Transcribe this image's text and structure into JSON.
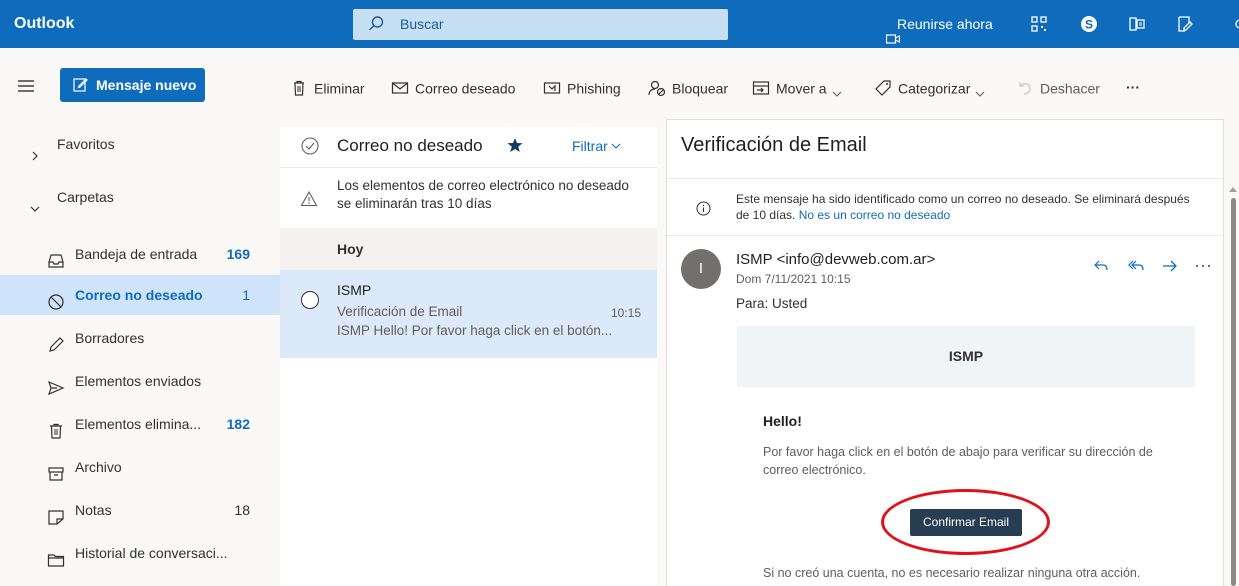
{
  "app": {
    "title": "Outlook"
  },
  "search": {
    "placeholder": "Buscar"
  },
  "header": {
    "meet_now": "Reunirse ahora",
    "icons": [
      "video-camera-icon",
      "qr-code-icon",
      "skype-icon",
      "office-icon",
      "feedback-icon"
    ]
  },
  "toolbar": {
    "new_message": "Mensaje nuevo",
    "delete": "Eliminar",
    "junk": "Correo deseado",
    "phishing": "Phishing",
    "block": "Bloquear",
    "move_to": "Mover a",
    "categorize": "Categorizar",
    "undo": "Deshacer",
    "more": "···"
  },
  "folders": {
    "favorites": "Favoritos",
    "folders_label": "Carpetas",
    "items": [
      {
        "label": "Bandeja de entrada",
        "count": "169"
      },
      {
        "label": "Correo no deseado",
        "count": "1"
      },
      {
        "label": "Borradores",
        "count": ""
      },
      {
        "label": "Elementos enviados",
        "count": ""
      },
      {
        "label": "Elementos elimina...",
        "count": "182"
      },
      {
        "label": "Archivo",
        "count": ""
      },
      {
        "label": "Notas",
        "count": "18"
      },
      {
        "label": "Historial de conversaci...",
        "count": ""
      }
    ]
  },
  "message_list": {
    "title": "Correo no deseado",
    "filter": "Filtrar",
    "banner": "Los elementos de correo electrónico no deseado se eliminarán tras 10 días",
    "group": "Hoy",
    "messages": [
      {
        "sender": "ISMP",
        "subject": "Verificación de Email",
        "time": "10:15",
        "preview": "ISMP Hello! Por favor haga click en el botón..."
      }
    ]
  },
  "reading": {
    "subject": "Verificación de Email",
    "junk_notice": "Este mensaje ha sido identificado como un correo no deseado. Se eliminará después de 10 días.",
    "not_junk_link": "No es un correo no deseado",
    "avatar_initial": "I",
    "from": "ISMP <info@devweb.com.ar>",
    "date": "Dom 7/11/2021 10:15",
    "to": "Para: Usted",
    "body": {
      "header": "ISMP",
      "greeting": "Hello!",
      "paragraph": "Por favor haga click en el botón de abajo para verificar su dirección de correo electrónico.",
      "button": "Confirmar Email",
      "footer": "Si no creó una cuenta, no es necesario realizar ninguna otra acción."
    }
  },
  "colors": {
    "brand": "#0f6cbd",
    "selected": "#cfe4fa",
    "highlight_ring": "#e2101a",
    "button_dark": "#273e52"
  }
}
